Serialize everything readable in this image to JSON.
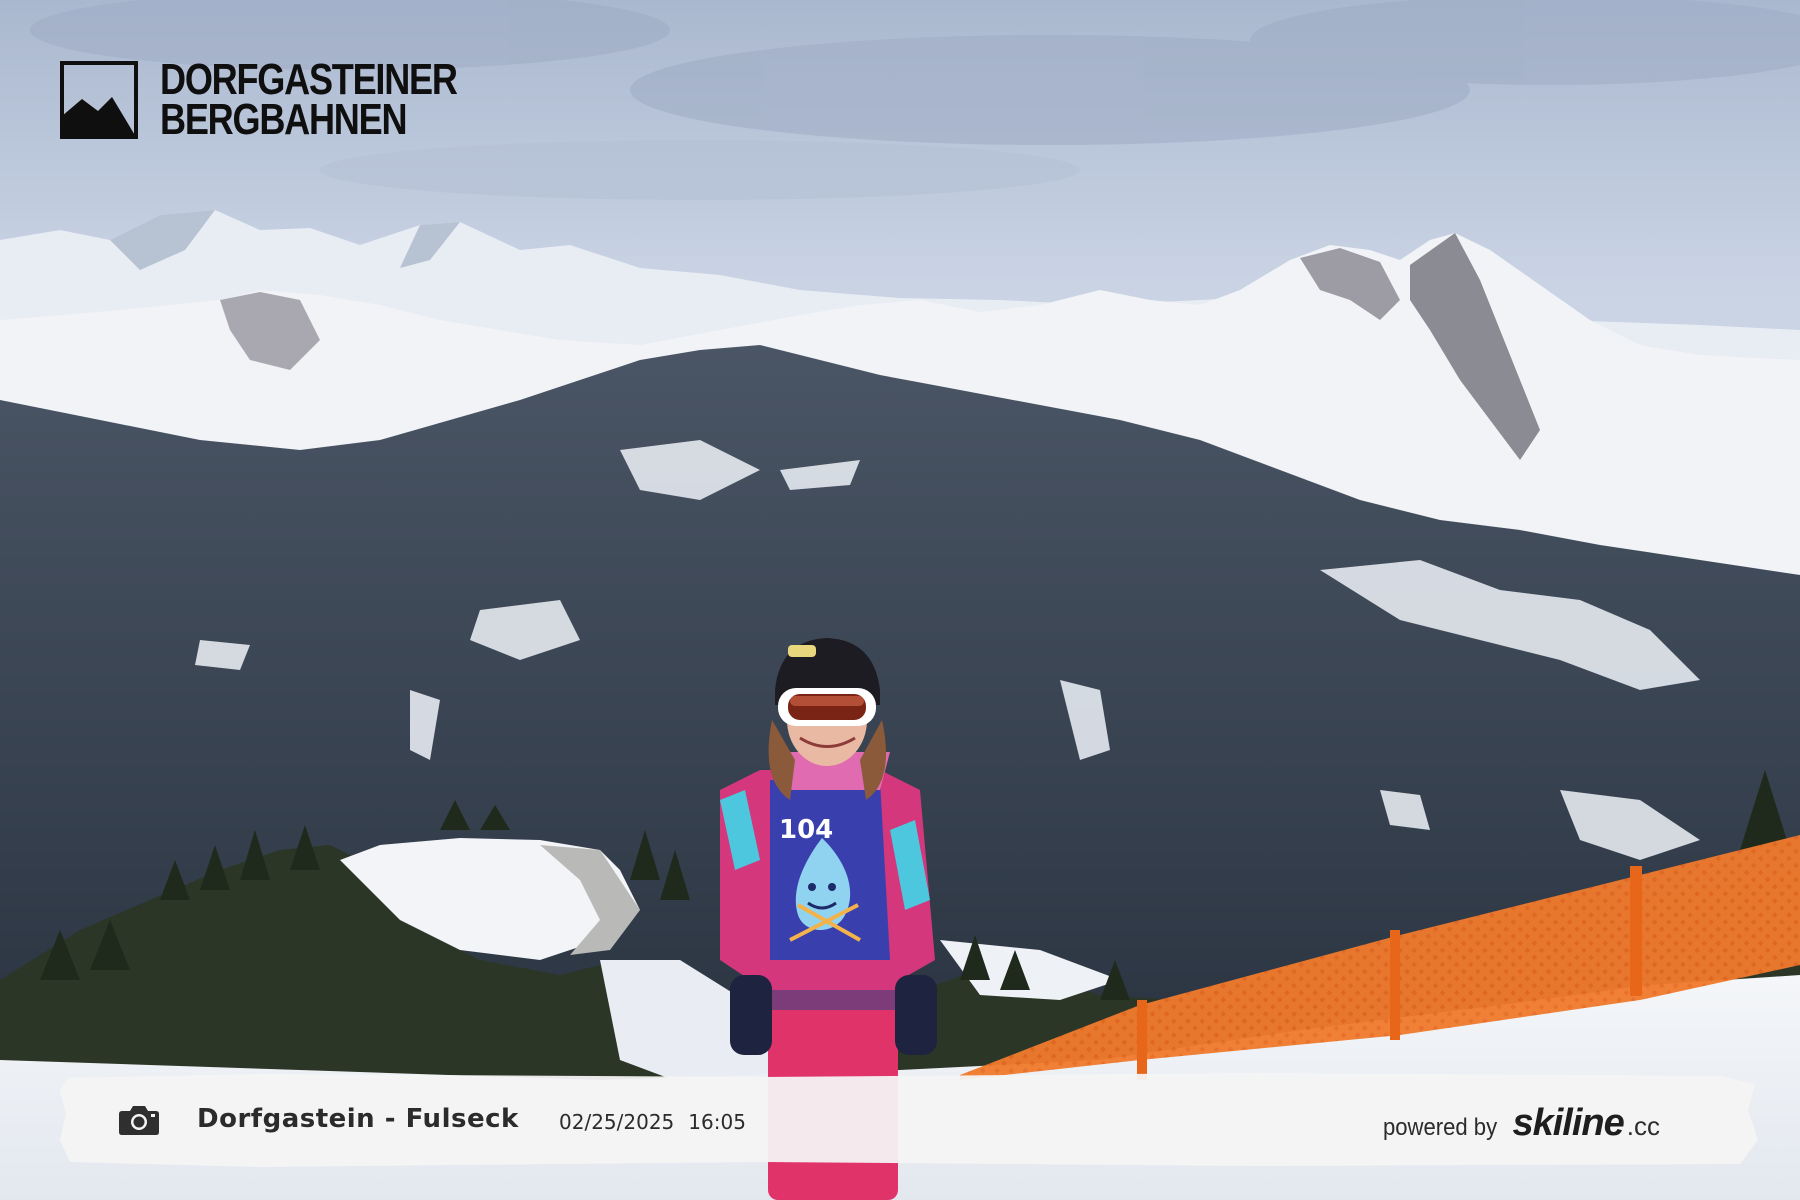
{
  "logo": {
    "line1": "DORFGASTEINER",
    "line2": "BERGBAHNEN",
    "icon": "mountain-logo-icon"
  },
  "caption": {
    "camera_icon": "camera-icon",
    "location": "Dorfgastein - Fulseck",
    "date": "02/25/2025",
    "time": "16:05",
    "powered_by": "powered by",
    "brand": "skiline",
    "brand_tld": ".cc"
  },
  "photo": {
    "bib_number": "104"
  },
  "colors": {
    "sky": "#c9d3e4",
    "snow": "#eef1f6",
    "forest": "#2f3a46",
    "fence": "#e8752a",
    "jacket_pink": "#d4377c",
    "bib_blue": "#3a3fae"
  }
}
